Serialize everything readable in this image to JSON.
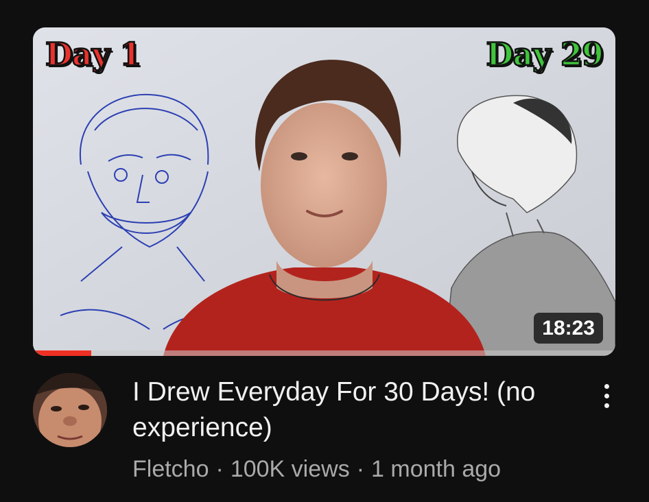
{
  "video": {
    "title": "I Drew Everyday For 30 Days! (no experience)",
    "duration": "18:23",
    "watch_progress_fraction": 0.1,
    "thumbnail": {
      "left_label": "Day 1",
      "right_label": "Day 29",
      "left_label_color": "#e8332f",
      "right_label_color": "#3fc43b"
    }
  },
  "channel": {
    "name": "Fletcho"
  },
  "meta": {
    "views": "100K views",
    "age": "1 month ago",
    "separator": "·"
  },
  "icons": {
    "more": "more-vert-icon",
    "avatar": "channel-avatar"
  },
  "colors": {
    "background": "#0f0f0f",
    "title_text": "#f1f1f1",
    "meta_text": "#aaaaaa",
    "progress": "#f03024"
  }
}
